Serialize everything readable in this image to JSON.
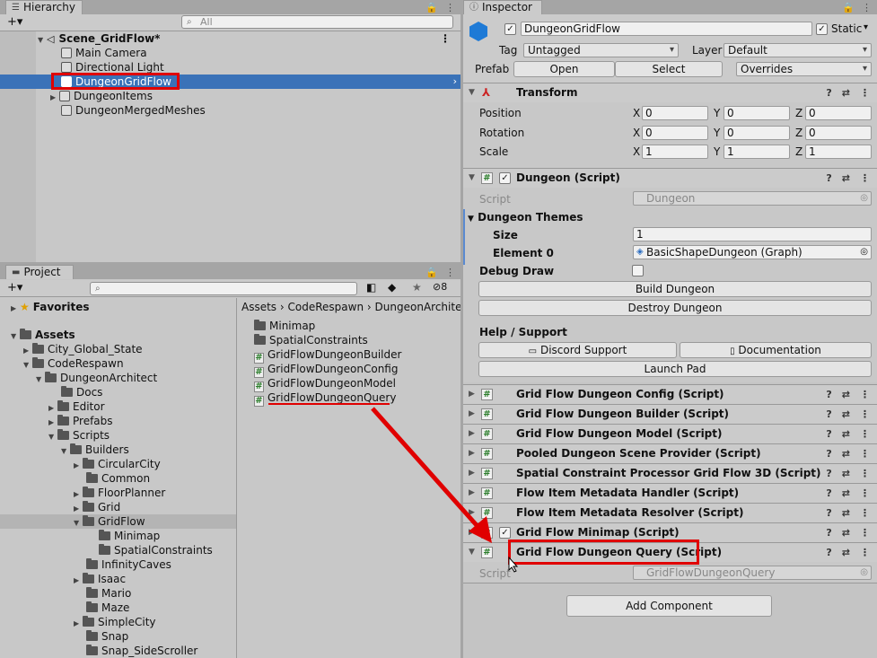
{
  "hierarchy": {
    "tab": "Hierarchy",
    "add": "+▾",
    "search_placeholder": "All",
    "scene": "Scene_GridFlow*",
    "items": [
      "Main Camera",
      "Directional Light",
      "DungeonGridFlow",
      "DungeonItems",
      "DungeonMergedMeshes"
    ]
  },
  "project": {
    "tab": "Project",
    "add": "+▾",
    "hidden_count": "8",
    "tree": [
      {
        "label": "Favorites",
        "kind": "fav"
      },
      {
        "label": "Assets",
        "kind": "bold"
      },
      {
        "label": "City_Global_State"
      },
      {
        "label": "CodeRespawn"
      },
      {
        "label": "DungeonArchitect"
      },
      {
        "label": "Docs"
      },
      {
        "label": "Editor"
      },
      {
        "label": "Prefabs"
      },
      {
        "label": "Scripts"
      },
      {
        "label": "Builders"
      },
      {
        "label": "CircularCity"
      },
      {
        "label": "Common"
      },
      {
        "label": "FloorPlanner"
      },
      {
        "label": "Grid"
      },
      {
        "label": "GridFlow"
      },
      {
        "label": "Minimap"
      },
      {
        "label": "SpatialConstraints"
      },
      {
        "label": "InfinityCaves"
      },
      {
        "label": "Isaac"
      },
      {
        "label": "Mario"
      },
      {
        "label": "Maze"
      },
      {
        "label": "SimpleCity"
      },
      {
        "label": "Snap"
      },
      {
        "label": "Snap_SideScroller"
      }
    ],
    "breadcrumb": [
      "Assets",
      "CodeRespawn",
      "DungeonArchite"
    ],
    "files": [
      "Minimap",
      "SpatialConstraints",
      "GridFlowDungeonBuilder",
      "GridFlowDungeonConfig",
      "GridFlowDungeonModel",
      "GridFlowDungeonQuery"
    ]
  },
  "inspector": {
    "tab": "Inspector",
    "name": "DungeonGridFlow",
    "static_label": "Static",
    "tag_label": "Tag",
    "tag_value": "Untagged",
    "layer_label": "Layer",
    "layer_value": "Default",
    "prefab_label": "Prefab",
    "open": "Open",
    "select": "Select",
    "overrides": "Overrides",
    "transform": {
      "title": "Transform",
      "rows": [
        {
          "label": "Position",
          "x": "0",
          "y": "0",
          "z": "0"
        },
        {
          "label": "Rotation",
          "x": "0",
          "y": "0",
          "z": "0"
        },
        {
          "label": "Scale",
          "x": "1",
          "y": "1",
          "z": "1"
        }
      ],
      "xl": "X",
      "yl": "Y",
      "zl": "Z"
    },
    "dungeon": {
      "title": "Dungeon (Script)",
      "script_label": "Script",
      "script_value": "Dungeon",
      "themes_label": "Dungeon Themes",
      "size_label": "Size",
      "size_value": "1",
      "element_label": "Element 0",
      "element_value": "BasicShapeDungeon (Graph)",
      "debug_label": "Debug Draw",
      "build": "Build Dungeon",
      "destroy": "Destroy Dungeon",
      "help_label": "Help / Support",
      "discord": "Discord Support",
      "docs": "Documentation",
      "launchpad": "Launch Pad"
    },
    "components": [
      "Grid Flow Dungeon Config (Script)",
      "Grid Flow Dungeon Builder (Script)",
      "Grid Flow Dungeon Model (Script)",
      "Pooled Dungeon Scene Provider (Script)",
      "Spatial Constraint Processor Grid Flow 3D (Script)",
      "Flow Item Metadata Handler (Script)",
      "Flow Item Metadata Resolver (Script)",
      "Grid Flow Minimap (Script)",
      "Grid Flow Dungeon Query (Script)"
    ],
    "query_script_label": "Script",
    "query_script_value": "GridFlowDungeonQuery",
    "add_component": "Add Component"
  },
  "colors": {
    "highlight": "#e00000",
    "selection": "#3a72b8"
  }
}
